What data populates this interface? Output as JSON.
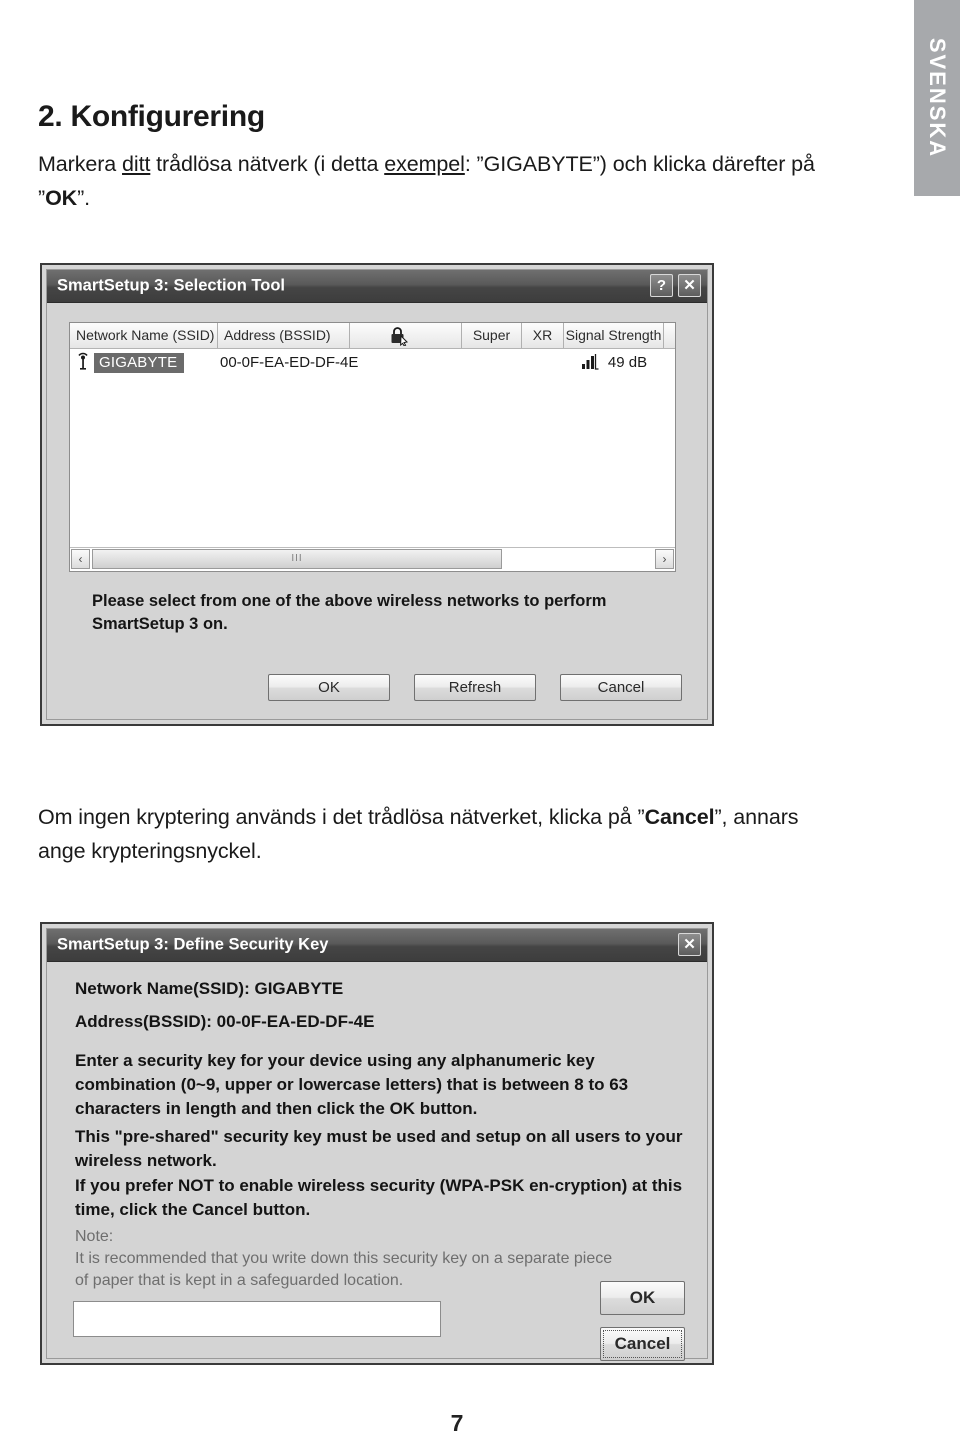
{
  "sidebar": {
    "language_tab": "SVENSKA"
  },
  "page": {
    "number": "7",
    "heading": "2. Konfigurering",
    "paragraph_1": {
      "seg_1": "Markera ",
      "underline_1": "ditt",
      "seg_2": " trådlösa nätverk (i detta ",
      "underline_2": "exempel",
      "seg_3": ": ”GIGABYTE”) och klicka därefter på ”",
      "bold_1": "OK",
      "seg_4": "”."
    },
    "paragraph_2": {
      "seg_1": "Om ingen kryptering används i det trådlösa nätverket, klicka på ”",
      "bold_1": "Cancel",
      "seg_2": "”, annars ange krypteringsnyckel."
    }
  },
  "selection_dialog": {
    "title": "SmartSetup 3: Selection Tool",
    "help_button": "?",
    "close_button": "✕",
    "columns": {
      "ssid": "Network Name (SSID)",
      "bssid": "Address (BSSID)",
      "security_icon": "lock-icon",
      "super": "Super",
      "xr": "XR",
      "signal": "Signal Strength"
    },
    "rows": [
      {
        "icon": "antenna-icon",
        "ssid": "GIGABYTE",
        "bssid": "00-0F-EA-ED-DF-4E",
        "super": "",
        "xr": "",
        "signal": "49 dB",
        "signal_bars": 3,
        "selected": true
      }
    ],
    "scrollbar": {
      "left_arrow": "‹",
      "right_arrow": "›",
      "grip": "III"
    },
    "hint_line_1": "Please select from one of the above wireless networks to perform",
    "hint_line_2": "SmartSetup 3 on.",
    "buttons": {
      "ok": "OK",
      "refresh": "Refresh",
      "cancel": "Cancel"
    }
  },
  "security_dialog": {
    "title": "SmartSetup 3: Define Security Key",
    "close_button": "✕",
    "ssid_line": "Network Name(SSID):  GIGABYTE",
    "bssid_line": "Address(BSSID):  00-0F-EA-ED-DF-4E",
    "paragraph_1": "Enter a security key for your device using any alphanumeric key combination (0~9, upper or lowercase letters) that is between 8 to 63 characters in length and then click the OK button.",
    "paragraph_2": "This \"pre-shared\" security key must be used and setup on all users to your wireless network.",
    "paragraph_3": "If you prefer NOT to enable wireless security (WPA-PSK en-cryption) at this time, click the Cancel button.",
    "note": "Note:\nIt is recommended that you write down this security key on a separate piece of paper that is kept in a safeguarded location.",
    "key_input_value": "",
    "key_input_placeholder": "",
    "buttons": {
      "ok": "OK",
      "cancel": "Cancel"
    }
  },
  "colors": {
    "tab_background": "#a7a9ac",
    "dialog_background": "#d4d4d4",
    "titlebar_dark": "#454545",
    "selection_highlight": "#6b6b6b"
  }
}
